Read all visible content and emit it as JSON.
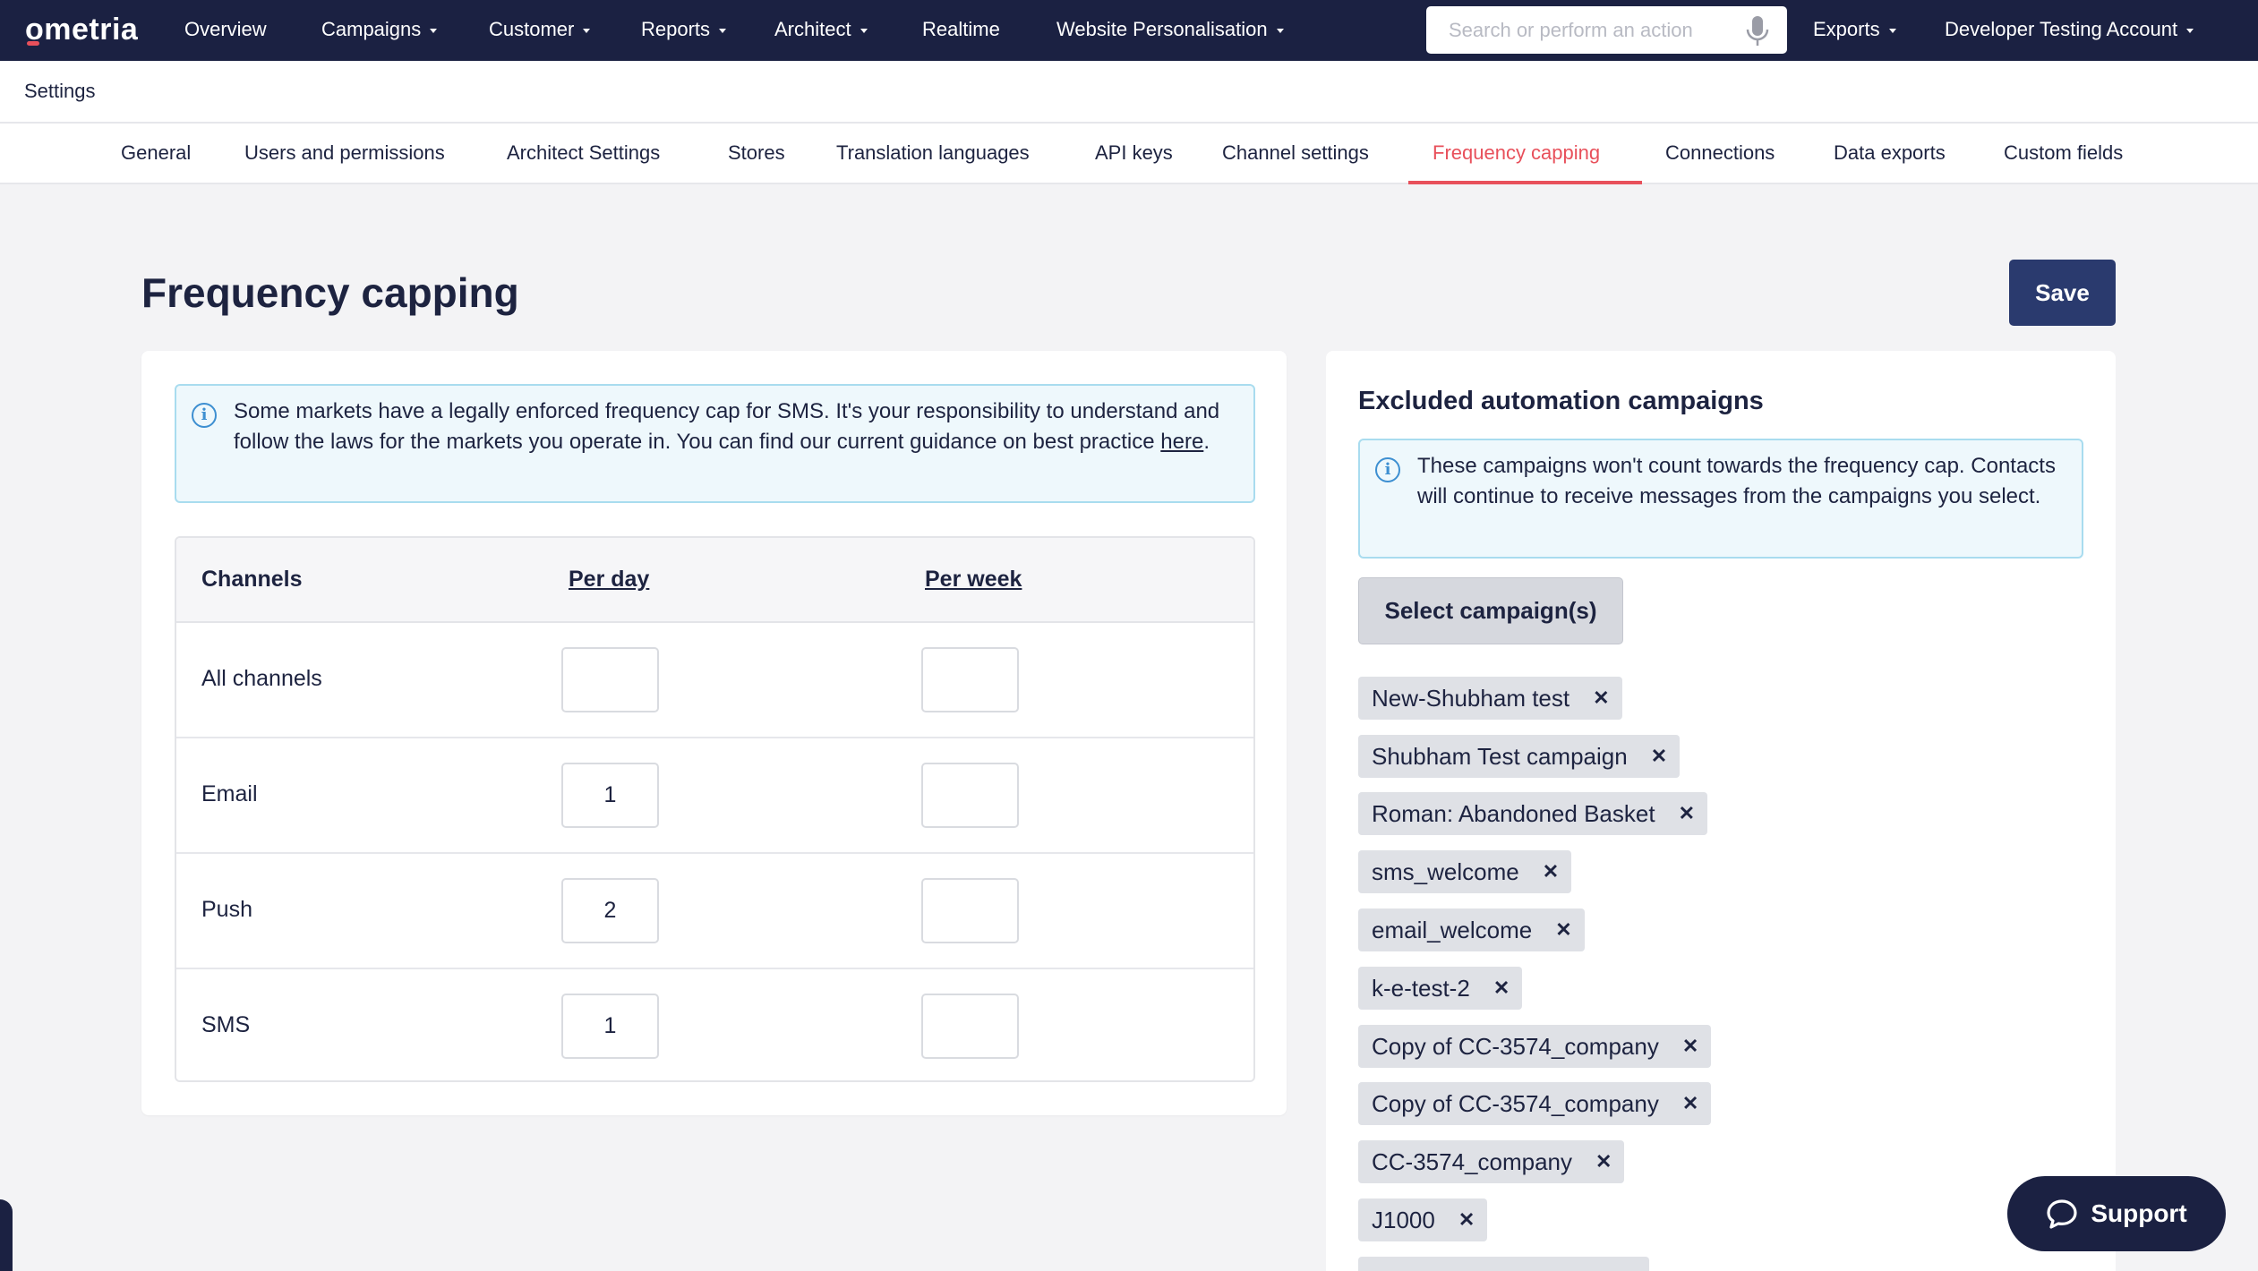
{
  "topnav": {
    "logo": "ometria",
    "items": [
      {
        "label": "Overview",
        "dropdown": false
      },
      {
        "label": "Campaigns",
        "dropdown": true
      },
      {
        "label": "Customer",
        "dropdown": true
      },
      {
        "label": "Reports",
        "dropdown": true
      },
      {
        "label": "Architect",
        "dropdown": true
      },
      {
        "label": "Realtime",
        "dropdown": false
      },
      {
        "label": "Website Personalisation",
        "dropdown": true
      }
    ],
    "search_placeholder": "Search or perform an action",
    "exports_label": "Exports",
    "account_label": "Developer Testing Account"
  },
  "settings_label": "Settings",
  "tabs": [
    {
      "label": "General"
    },
    {
      "label": "Users and permissions"
    },
    {
      "label": "Architect Settings"
    },
    {
      "label": "Stores"
    },
    {
      "label": "Translation languages"
    },
    {
      "label": "API keys"
    },
    {
      "label": "Channel settings"
    },
    {
      "label": "Frequency capping",
      "active": true
    },
    {
      "label": "Connections"
    },
    {
      "label": "Data exports"
    },
    {
      "label": "Custom fields"
    }
  ],
  "page": {
    "title": "Frequency capping",
    "save_label": "Save"
  },
  "left_alert": {
    "text": "Some markets have a legally enforced frequency cap for SMS. It's your responsibility to understand and follow the laws for the markets you operate in. You can find our current guidance on best practice ",
    "link_text": "here",
    "suffix": "."
  },
  "table": {
    "headers": {
      "channels": "Channels",
      "per_day": "Per day",
      "per_week": "Per week"
    },
    "rows": [
      {
        "channel": "All channels",
        "per_day": "",
        "per_week": ""
      },
      {
        "channel": "Email",
        "per_day": "1",
        "per_week": ""
      },
      {
        "channel": "Push",
        "per_day": "2",
        "per_week": ""
      },
      {
        "channel": "SMS",
        "per_day": "1",
        "per_week": ""
      }
    ]
  },
  "right_panel": {
    "title": "Excluded automation campaigns",
    "alert_text": "These campaigns won't count towards the frequency cap. Contacts will continue to receive messages from the campaigns you select.",
    "select_label": "Select campaign(s)",
    "campaigns": [
      "New-Shubham test",
      "Shubham Test campaign",
      "Roman: Abandoned Basket",
      "sms_welcome",
      "email_welcome",
      "k-e-test-2",
      "Copy of CC-3574_company",
      "Copy of CC-3574_company",
      "CC-3574_company",
      "J1000"
    ]
  },
  "support_label": "Support",
  "colors": {
    "nav_bg": "#1b2142",
    "accent": "#e8505b",
    "primary_button": "#2a3a6e"
  }
}
